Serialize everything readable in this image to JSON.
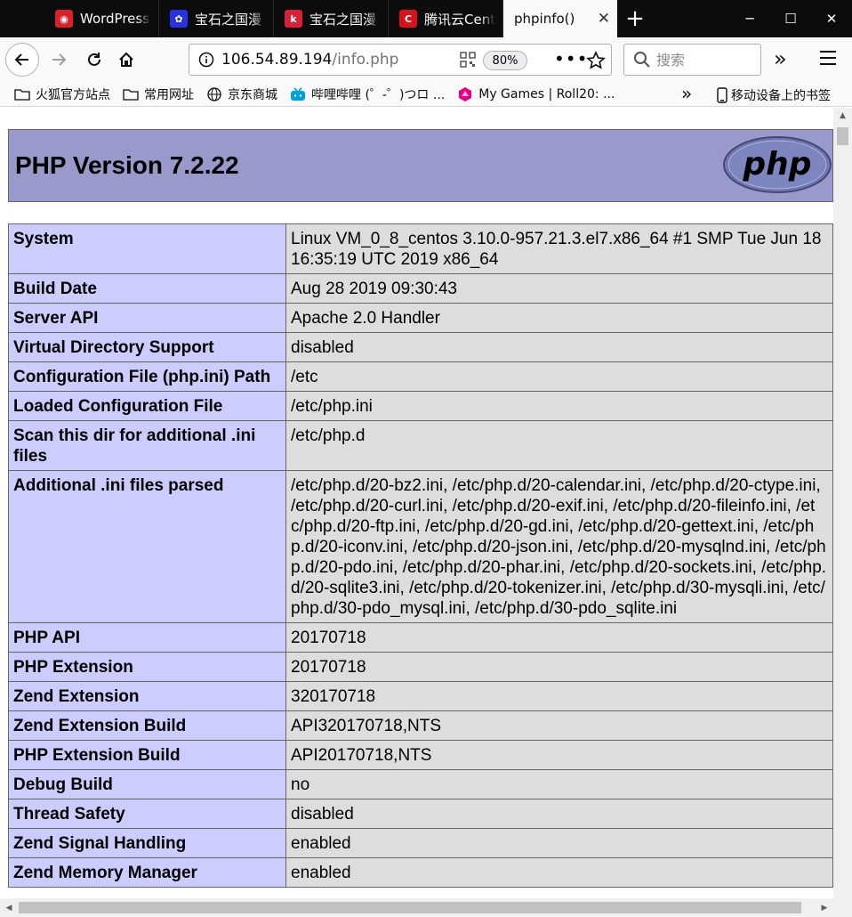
{
  "browser": {
    "tabs": [
      {
        "label": "WordPress",
        "favicon": "owl-icon",
        "color": "#d7212b",
        "glyph": "◉"
      },
      {
        "label": "宝石之国漫",
        "favicon": "baidu-paw-icon",
        "color": "#2932e1",
        "glyph": "✿"
      },
      {
        "label": "宝石之国漫",
        "favicon": "manga-k-icon",
        "color": "#d7213b",
        "glyph": "k"
      },
      {
        "label": "腾讯云Cent",
        "favicon": "tencent-cloud-icon",
        "color": "#d5121d",
        "glyph": "C"
      },
      {
        "label": "phpinfo()",
        "favicon": "",
        "color": "",
        "glyph": ""
      }
    ],
    "new_tab_glyph": "+",
    "window": {
      "minimize": "─",
      "maximize": "☐",
      "close": "✕"
    },
    "url": {
      "host": "106.54.89.194",
      "path": "/info.php"
    },
    "zoom": "80%",
    "search_placeholder": "搜索",
    "bookmarks": [
      {
        "label": "火狐官方站点",
        "icon": "folder-icon"
      },
      {
        "label": "常用网址",
        "icon": "folder-icon"
      },
      {
        "label": "京东商城",
        "icon": "globe-icon"
      },
      {
        "label": "哔哩哔哩 (゜-゜)つロ ...",
        "icon": "bilibili-icon"
      },
      {
        "label": "My Games | Roll20: ...",
        "icon": "roll20-icon"
      }
    ],
    "bookmarks_overflow": "»",
    "mobile_bookmarks": "移动设备上的书签"
  },
  "php": {
    "title": "PHP Version 7.2.22",
    "logo_text": "php",
    "rows": [
      {
        "k": "System",
        "v": "Linux VM_0_8_centos 3.10.0-957.21.3.el7.x86_64 #1 SMP Tue Jun 18 16:35:19 UTC 2019 x86_64"
      },
      {
        "k": "Build Date",
        "v": "Aug 28 2019 09:30:43"
      },
      {
        "k": "Server API",
        "v": "Apache 2.0 Handler"
      },
      {
        "k": "Virtual Directory Support",
        "v": "disabled"
      },
      {
        "k": "Configuration File (php.ini) Path",
        "v": "/etc"
      },
      {
        "k": "Loaded Configuration File",
        "v": "/etc/php.ini"
      },
      {
        "k": "Scan this dir for additional .ini files",
        "v": "/etc/php.d"
      },
      {
        "k": "Additional .ini files parsed",
        "v": "/etc/php.d/20-bz2.ini, /etc/php.d/20-calendar.ini, /etc/php.d/20-ctype.ini, /etc/php.d/20-curl.ini, /etc/php.d/20-exif.ini, /etc/php.d/20-fileinfo.ini, /etc/php.d/20-ftp.ini, /etc/php.d/20-gd.ini, /etc/php.d/20-gettext.ini, /etc/php.d/20-iconv.ini, /etc/php.d/20-json.ini, /etc/php.d/20-mysqlnd.ini, /etc/php.d/20-pdo.ini, /etc/php.d/20-phar.ini, /etc/php.d/20-sockets.ini, /etc/php.d/20-sqlite3.ini, /etc/php.d/20-tokenizer.ini, /etc/php.d/30-mysqli.ini, /etc/php.d/30-pdo_mysql.ini, /etc/php.d/30-pdo_sqlite.ini"
      },
      {
        "k": "PHP API",
        "v": "20170718"
      },
      {
        "k": "PHP Extension",
        "v": "20170718"
      },
      {
        "k": "Zend Extension",
        "v": "320170718"
      },
      {
        "k": "Zend Extension Build",
        "v": "API320170718,NTS"
      },
      {
        "k": "PHP Extension Build",
        "v": "API20170718,NTS"
      },
      {
        "k": "Debug Build",
        "v": "no"
      },
      {
        "k": "Thread Safety",
        "v": "disabled"
      },
      {
        "k": "Zend Signal Handling",
        "v": "enabled"
      },
      {
        "k": "Zend Memory Manager",
        "v": "enabled"
      }
    ]
  },
  "colors": {
    "header_bg": "#9999cc",
    "key_cell_bg": "#ccccff",
    "value_cell_bg": "#dddddd",
    "tabstrip_bg": "#0c0c0d"
  }
}
